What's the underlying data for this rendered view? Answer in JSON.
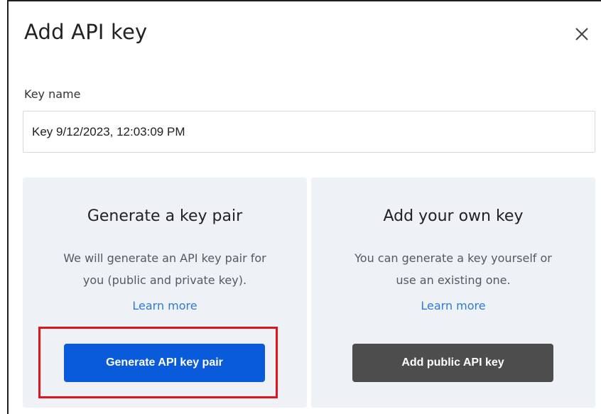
{
  "dialog": {
    "title": "Add API key",
    "close_symbol": "✕"
  },
  "key_name": {
    "label": "Key name",
    "value": "Key 9/12/2023, 12:03:09 PM"
  },
  "panels": [
    {
      "title": "Generate a key pair",
      "description": [
        "We will generate an API key pair for",
        "you (public and private key)."
      ],
      "learn_more": "Learn more",
      "button_label": "Generate API key pair"
    },
    {
      "title": "Add your own key",
      "description": [
        "You can generate a key yourself or",
        "use an existing one."
      ],
      "learn_more": "Learn more",
      "button_label": "Add public API key"
    }
  ],
  "colors": {
    "primary_button": "#0a5bdc",
    "dark_button": "#4d4d4d",
    "link": "#2f7ad6",
    "panel_bg": "#eef1f6",
    "highlight": "#e0141c"
  }
}
